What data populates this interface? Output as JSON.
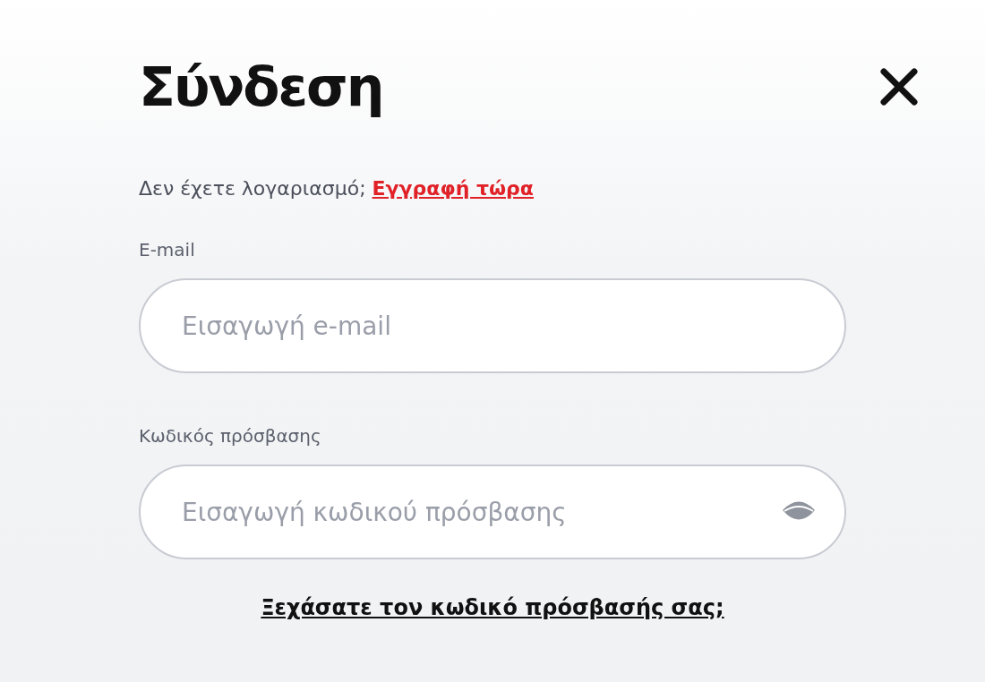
{
  "dialog": {
    "title": "Σύνδεση"
  },
  "signup_prompt": {
    "text": "Δεν έχετε λογαριασμό;",
    "link": "Εγγραφή τώρα"
  },
  "fields": [
    {
      "kind": "email",
      "label": "E-mail",
      "placeholder": "Εισαγωγή e-mail"
    },
    {
      "kind": "password",
      "label": "Κωδικός πρόσβασης",
      "placeholder": "Εισαγωγή κωδικού πρόσβασης"
    }
  ],
  "forgot_link": "Ξεχάσατε τον κωδικό πρόσβασής σας;"
}
